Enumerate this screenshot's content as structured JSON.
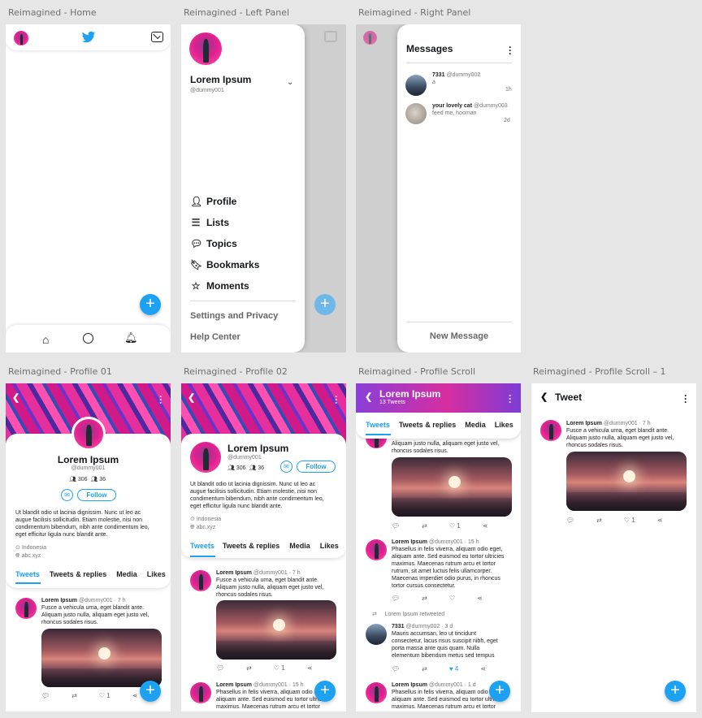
{
  "frames": {
    "home": "Reimagined - Home",
    "left": "Reimagined - Left Panel",
    "right": "Reimagined - Right Panel",
    "profile01": "Reimagined - Profile 01",
    "profile02": "Reimagined - Profile 02",
    "pscroll": "Reimagined - Profile Scroll",
    "pscroll1": "Reimagined - Profile Scroll – 1"
  },
  "user": {
    "name": "Lorem Ipsum",
    "handle": "@dummy001",
    "followers": "306",
    "following": "36",
    "location": "Indonesia",
    "site": "abc.xyz",
    "tweets_count": "13 Tweets",
    "bio1": "Ut blandit odio ut lacinia dignissim. Nunc ut leo ac",
    "bio2": "augue facilisis sollicitudin. Etiam molestie, nisi non",
    "bio3": "condimentum bibendum, nibh ante condimentum leo,",
    "bio4": "eget efficitur ligula nunc blandit ante."
  },
  "left_menu": {
    "profile": "Profile",
    "lists": "Lists",
    "topics": "Topics",
    "bookmarks": "Bookmarks",
    "moments": "Moments",
    "settings": "Settings and Privacy",
    "help": "Help Center"
  },
  "messages": {
    "title": "Messages",
    "new_message": "New Message",
    "items": [
      {
        "name": "7331",
        "handle": "@dummy002",
        "text": "a",
        "time": "1h"
      },
      {
        "name": "your lovely cat",
        "handle": "@dummy003",
        "text": "feed me, hooman",
        "time": "2d"
      }
    ]
  },
  "tabs": {
    "tweets": "Tweets",
    "replies": "Tweets & replies",
    "media": "Media",
    "likes": "Likes"
  },
  "follow": "Follow",
  "tweet_header": "Tweet",
  "tweet1": {
    "name": "Lorem Ipsum",
    "handle": "@dummy001 · 7 h",
    "l1": "Fusce a vehicula urna, eget blandit ante.",
    "l2": "Aliquam justo nulla, aliquam eget justo vel,",
    "l3": "rhoncus sodales risus.",
    "likes": "1"
  },
  "tweet2": {
    "name": "Lorem Ipsum",
    "handle": "@dummy001 · 15 h",
    "l1": "Phasellus in felis viverra, aliquam odio eget,",
    "l2": "aliquam ante. Sed euismod eu tortor ultricies",
    "l3": "maximus. Maecenas rutrum arcu et tortor",
    "l4": "rutrum, sit amet luctus felis ullamcorper.",
    "l5": "Maecenas imperdiet odio purus, in rhoncus",
    "l6": "tortor cursus consectetur."
  },
  "retweet": {
    "label": "Lorem Ipsum retweeted",
    "name": "7331",
    "handle": "@dummy002 · 3 d",
    "l1": "Mauris accumsan, leo ut tincidunt",
    "l2": "consectetur, lacus risus suscipit nibh, eget",
    "l3": "porta massa ante quis quam. Nulla",
    "l4": "elementum bibendum metus sed tempus",
    "likes": "4"
  },
  "scroll_top": {
    "l1": "Aliquam justo nulla, aliquam eget justo vel,",
    "l2": "rhoncus sodales risus."
  },
  "tweet_d1": {
    "handle": "@dummy001 · 1 d",
    "l1": "Phasellus in felis viverra, aliquam odio egr",
    "l2": "aliquam ante. Sed euismod eu tortor ultric",
    "l3": "maximus. Maecenas rutrum arcu et tortor"
  },
  "colors": {
    "accent": "#1da1f2",
    "pink": "#e62e9c",
    "purple": "#6a34c8"
  }
}
